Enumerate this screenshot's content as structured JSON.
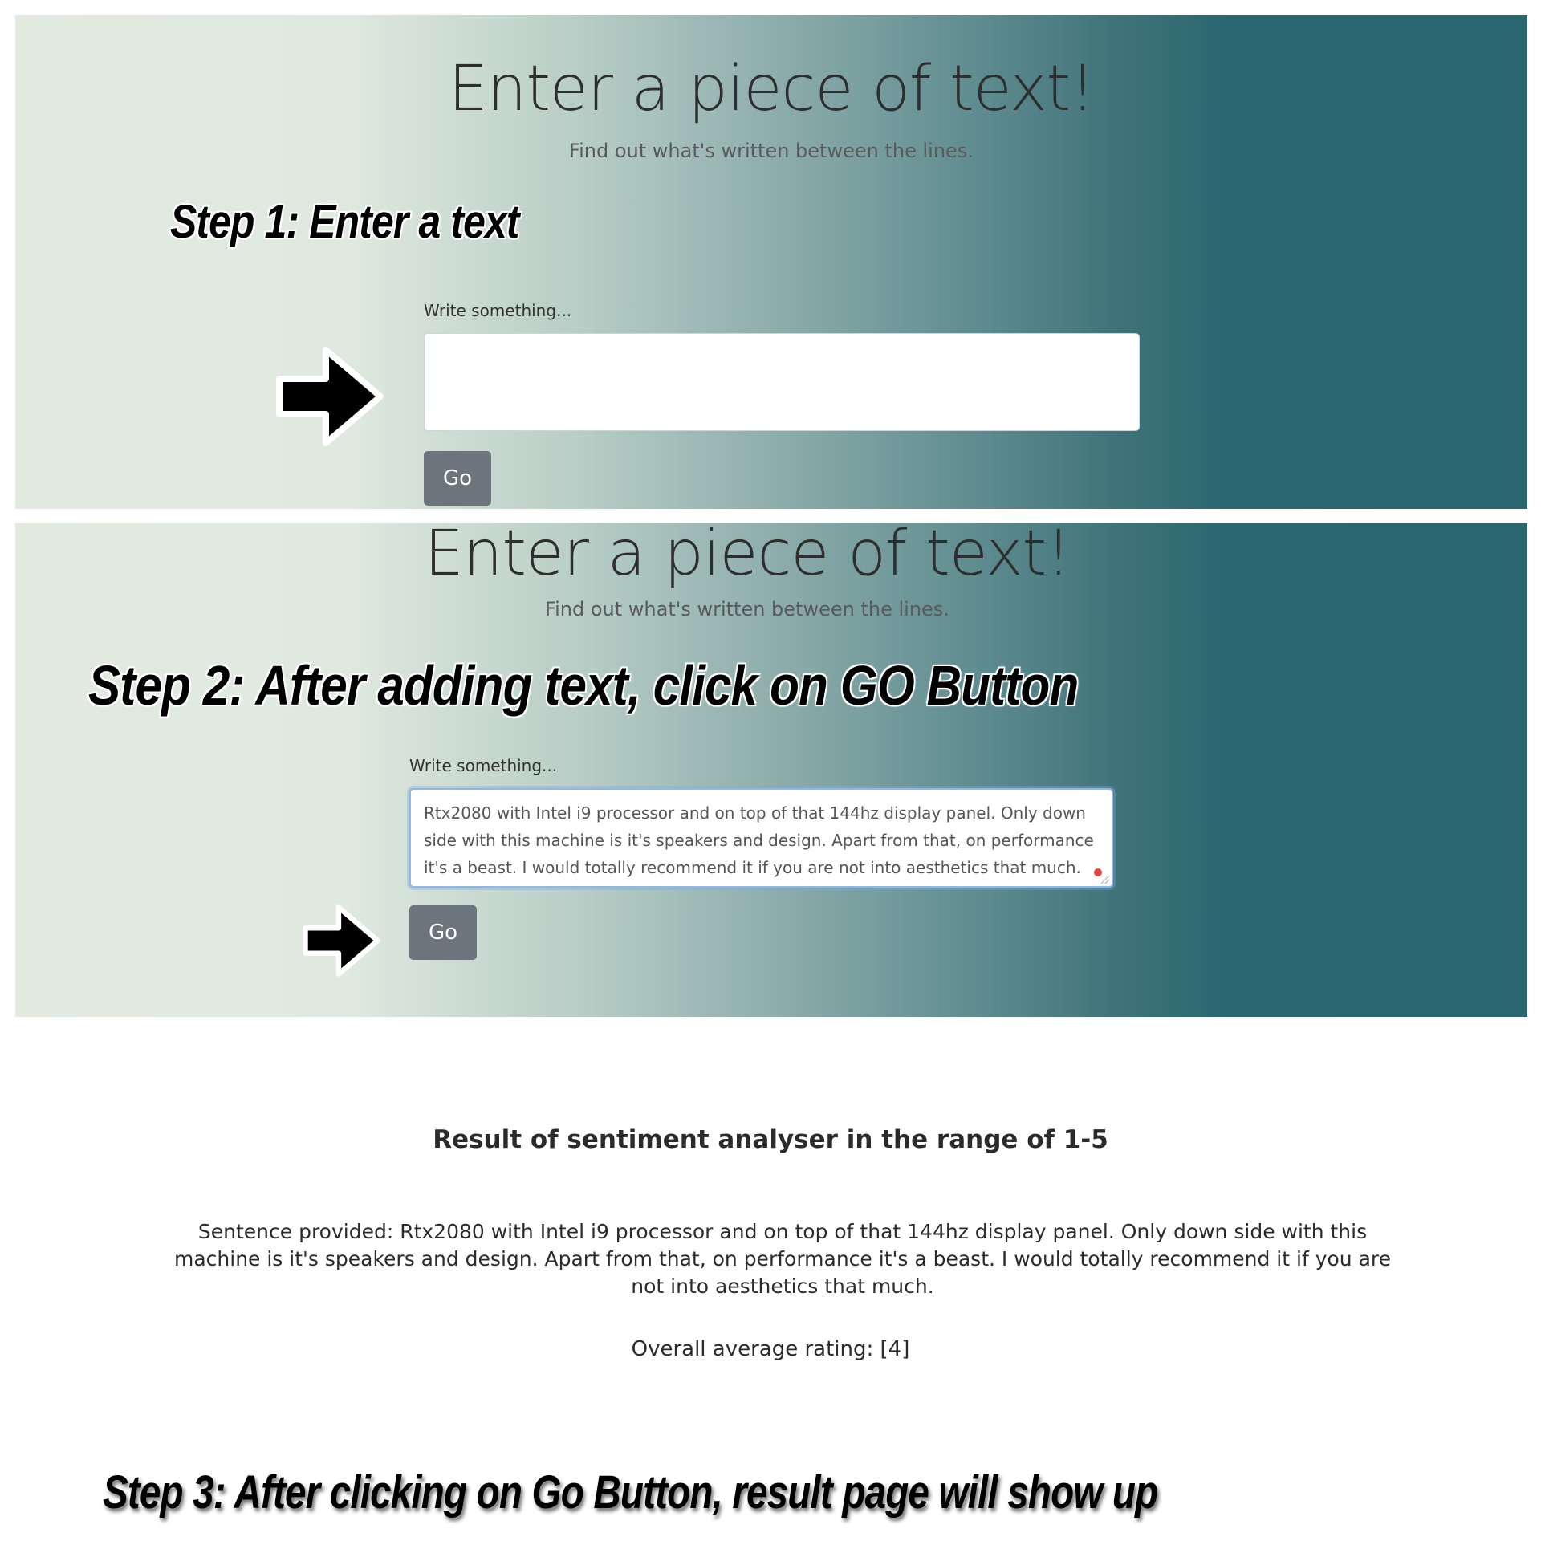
{
  "hero": {
    "title": "Enter a piece of text!",
    "subtitle": "Find out what's written between the lines."
  },
  "steps": {
    "step1": "Step 1: Enter a text",
    "step2": "Step 2: After adding text, click on GO Button",
    "step3": "Step 3: After clicking on Go Button, result page will show up"
  },
  "form": {
    "label": "Write something...",
    "empty_value": "",
    "filled_value": "Rtx2080 with Intel i9 processor and on top of that 144hz display panel. Only down side with this machine is it's speakers and design. Apart from that, on performance it's a beast. I would totally recommend it if you are not into aesthetics that much.",
    "button_label": "Go"
  },
  "result": {
    "title": "Result of sentiment analyser in the range of 1-5",
    "sentence": "Sentence provided: Rtx2080 with Intel i9 processor and on top of that 144hz display panel. Only down side with this machine is it's speakers and design. Apart from that, on performance it's a beast. I would totally recommend it if you are not into aesthetics that much.",
    "rating": "Overall average rating: [4]"
  },
  "icons": {
    "pointer_arrow": "arrow-right-icon"
  },
  "colors": {
    "panel_left": "#e3ebe1",
    "panel_right": "#296670",
    "button_bg": "#6c757d",
    "focus_ring": "#8fb8e3",
    "spell_dot": "#e0463d"
  }
}
